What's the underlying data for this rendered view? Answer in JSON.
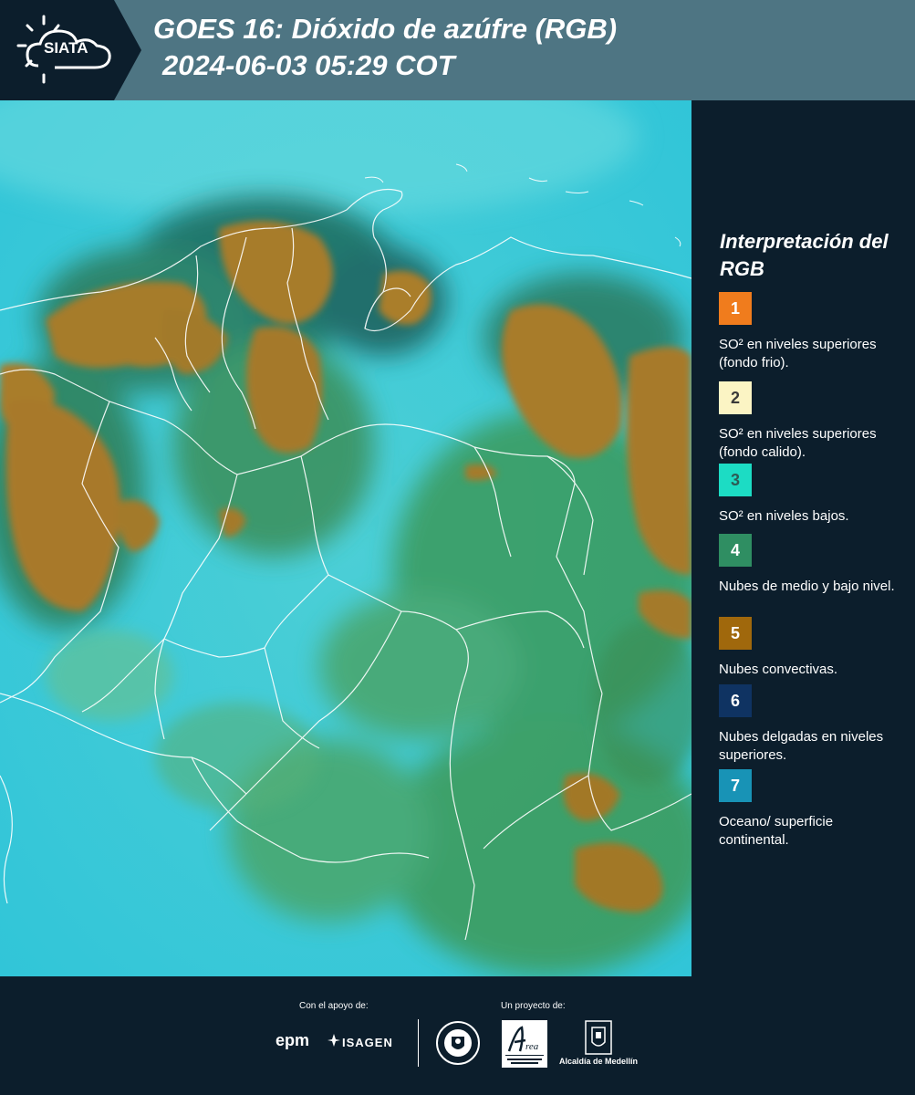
{
  "header": {
    "logo_text": "SIATA",
    "title_line1": "GOES 16: Dióxido de azúfre (RGB)",
    "title_line2": "2024-06-03 05:29 COT"
  },
  "map": {
    "description_icon": "satellite-rgb-map"
  },
  "legend": {
    "title": "Interpretación del RGB",
    "items": [
      {
        "number": "1",
        "label": "SO² en niveles superiores (fondo frio).",
        "color": "#f07c1d",
        "text_color": "#ffffff"
      },
      {
        "number": "2",
        "label": "SO² en niveles superiores (fondo calido).",
        "color": "#fbf4c4",
        "text_color": "#3a3a3a"
      },
      {
        "number": "3",
        "label": "SO² en niveles bajos.",
        "color": "#1cdcc4",
        "text_color": "#2d5b55"
      },
      {
        "number": "4",
        "label": "Nubes de medio y bajo nivel.",
        "color": "#2f8e62",
        "text_color": "#ffffff"
      },
      {
        "number": "5",
        "label": "Nubes convectivas.",
        "color": "#a0680c",
        "text_color": "#ffffff"
      },
      {
        "number": "6",
        "label": "Nubes delgadas en niveles superiores.",
        "color": "#0f3362",
        "text_color": "#ffffff"
      },
      {
        "number": "7",
        "label": "Oceano/ superficie continental.",
        "color": "#1893b6",
        "text_color": "#ffffff"
      }
    ]
  },
  "footer": {
    "support_caption": "Con el apoyo de:",
    "project_caption": "Un proyecto de:",
    "epm_logo": "epm",
    "isagen_logo": "ISAGEN",
    "alcaldia_text": "Alcaldía de Medellín",
    "seal_icon": "medellin-seal-icon",
    "area_logo_icon": "area-metropolitana-logo-icon"
  }
}
